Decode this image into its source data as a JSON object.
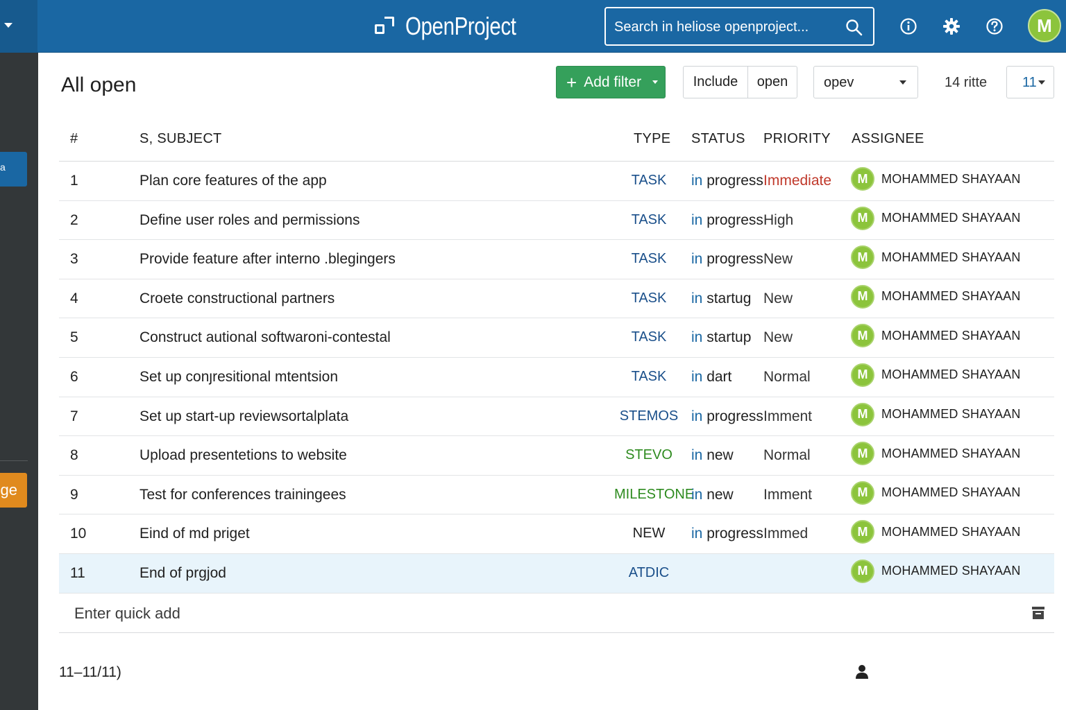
{
  "header": {
    "app_name": "OpenProject",
    "search_placeholder": "Search in heliose openproject...",
    "avatar_initial": "M",
    "colors": {
      "header_bg": "#1a67a3",
      "avatar_bg": "#8cc43c"
    }
  },
  "sidebar": {
    "blue_button_label": "a",
    "orange_button_label": "ge"
  },
  "toolbar": {
    "title": "All open",
    "add_filter_label": "Add filter",
    "include_label": "Include",
    "include_value": "open",
    "select_value": "opev",
    "count_label": "14 ritte",
    "per_page_value": "11"
  },
  "table": {
    "headers": {
      "num": "#",
      "subject": "S, SUBJECT",
      "type": "TYPE",
      "status": "STATUS",
      "priority": "PRIORITY",
      "assignee": "ASSIGNEE"
    },
    "rows": [
      {
        "num": "1",
        "subject": "Plan core features of the app",
        "type": "TASK",
        "type_color": "#1a4f8a",
        "status": "in progress",
        "priority": "Immediate",
        "priority_color": "#c0392b",
        "assignee": "MOHAMMED SHAYAAN",
        "avatar": "M"
      },
      {
        "num": "2",
        "subject": "Define user roles and permissions",
        "type": "TASK",
        "type_color": "#1a4f8a",
        "status": "in progress",
        "priority": "High",
        "priority_color": "#333333",
        "assignee": "MOHAMMED SHAYAAN",
        "avatar": "M"
      },
      {
        "num": "3",
        "subject": "Provide feature after interno .blegingers",
        "type": "TASK",
        "type_color": "#1a4f8a",
        "status": "in progress",
        "priority": "New",
        "priority_color": "#333333",
        "assignee": "MOHAMMED SHAYAAN",
        "avatar": "M"
      },
      {
        "num": "4",
        "subject": "Croete constructional partners",
        "type": "TASK",
        "type_color": "#1a4f8a",
        "status": "in startug",
        "priority": "New",
        "priority_color": "#333333",
        "assignee": "MOHAMMED SHAYAAN",
        "avatar": "M"
      },
      {
        "num": "5",
        "subject": "Construct autional softwaroni-contestal",
        "type": "TASK",
        "type_color": "#1a4f8a",
        "status": "in startup",
        "priority": "New",
        "priority_color": "#333333",
        "assignee": "MOHAMMED SHAYAAN",
        "avatar": "M"
      },
      {
        "num": "6",
        "subject": "Set up conȷresitional mtentsion",
        "type": "TASK",
        "type_color": "#1a4f8a",
        "status": "in dart",
        "priority": "Normal",
        "priority_color": "#333333",
        "assignee": "MOHAMMED SHAYAAN",
        "avatar": "M"
      },
      {
        "num": "7",
        "subject": "Set up start-up reviewsortalplata",
        "type": "STEMOS",
        "type_color": "#1a4f8a",
        "status": "in progress",
        "priority": "Imment",
        "priority_color": "#333333",
        "assignee": "MOHAMMED SHAYAAN",
        "avatar": "M"
      },
      {
        "num": "8",
        "subject": "Upload presentetions to website",
        "type": "STEVO",
        "type_color": "#2e8b1f",
        "status": "in new",
        "priority": "Normal",
        "priority_color": "#333333",
        "assignee": "MOHAMMED SHAYAAN",
        "avatar": "M"
      },
      {
        "num": "9",
        "subject": "Test for conferences trainingees",
        "type": "MILESTONE",
        "type_color": "#2e8b1f",
        "status": "in new",
        "priority": "Imment",
        "priority_color": "#333333",
        "assignee": "MOHAMMED SHAYAAN",
        "avatar": "M"
      },
      {
        "num": "10",
        "subject": "Eind of md priget",
        "type": "NEW",
        "type_color": "#1f1f1f",
        "status": "in progress",
        "priority": "Immed",
        "priority_color": "#333333",
        "assignee": "MOHAMMED SHAYAAN",
        "avatar": "M"
      },
      {
        "num": "11",
        "subject": "End of prgjod",
        "type": "ATDIC",
        "type_color": "#1a4f8a",
        "status": "",
        "priority": "",
        "priority_color": "#333333",
        "assignee": "MOHAMMED SHAYAAN",
        "avatar": "M"
      }
    ],
    "status_in_color": "#1a67a3",
    "quick_add_label": "Enter quick add"
  },
  "footer": {
    "pagination": "11–11/11)"
  }
}
